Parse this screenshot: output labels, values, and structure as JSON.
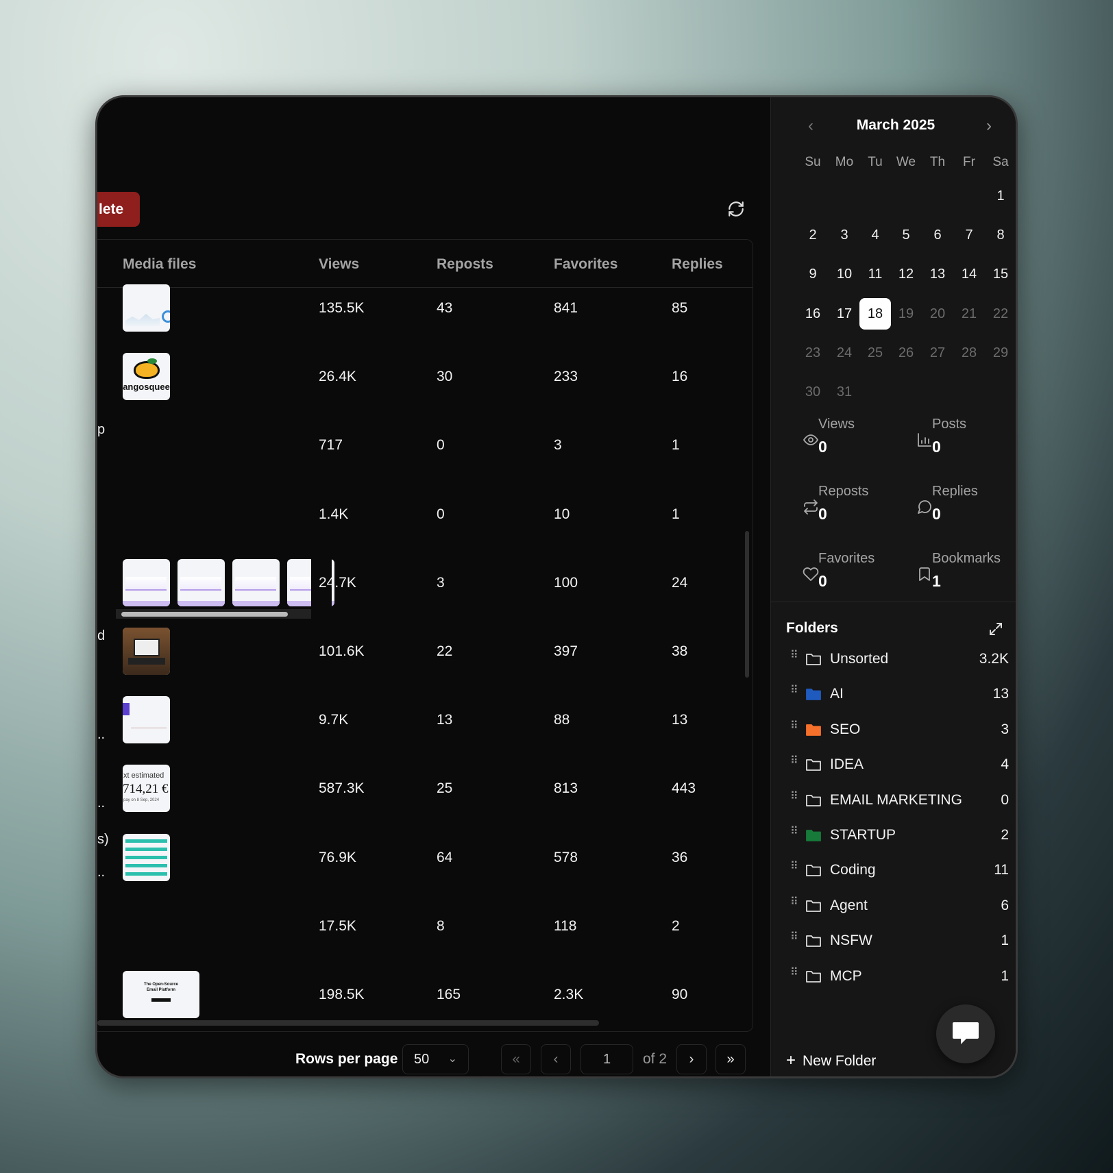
{
  "toolbar": {
    "delete_label": "lete",
    "refresh_icon": "refresh-icon"
  },
  "table": {
    "columns": [
      "Media files",
      "Views",
      "Reposts",
      "Favorites",
      "Replies"
    ],
    "rows": [
      {
        "fragment": "",
        "views": "135.5K",
        "reposts": "43",
        "favorites": "841",
        "replies": "85",
        "thumbs": [
          "analytics-screenshot"
        ]
      },
      {
        "fragment": "",
        "views": "26.4K",
        "reposts": "30",
        "favorites": "233",
        "replies": "16",
        "thumbs": [
          "mango-logo"
        ],
        "logo_text": "angosquee"
      },
      {
        "fragment": "p",
        "views": "717",
        "reposts": "0",
        "favorites": "3",
        "replies": "1",
        "thumbs": []
      },
      {
        "fragment": "",
        "views": "1.4K",
        "reposts": "0",
        "favorites": "10",
        "replies": "1",
        "thumbs": []
      },
      {
        "fragment": "",
        "views": "24.7K",
        "reposts": "3",
        "favorites": "100",
        "replies": "24",
        "thumbs": [
          "chart-screenshot",
          "chart-screenshot",
          "chart-screenshot",
          "chart-screenshot"
        ]
      },
      {
        "fragment": "d",
        "views": "101.6K",
        "reposts": "22",
        "favorites": "397",
        "replies": "38",
        "thumbs": [
          "laptop-photo"
        ]
      },
      {
        "fragment": "..",
        "views": "9.7K",
        "reposts": "13",
        "favorites": "88",
        "replies": "13",
        "thumbs": [
          "dashboard-screenshot"
        ]
      },
      {
        "fragment": "..",
        "views": "587.3K",
        "reposts": "25",
        "favorites": "813",
        "replies": "443",
        "thumbs": [
          "earnings-screenshot"
        ],
        "thumb_text": [
          "xt estimated",
          "714,21 €",
          "pay on 8 Sep, 2024"
        ]
      },
      {
        "fragment": "s)",
        "fragment2": "..",
        "views": "76.9K",
        "reposts": "64",
        "favorites": "578",
        "replies": "36",
        "thumbs": [
          "list-screenshot"
        ]
      },
      {
        "fragment": "",
        "views": "17.5K",
        "reposts": "8",
        "favorites": "118",
        "replies": "2",
        "thumbs": []
      },
      {
        "fragment": "",
        "views": "198.5K",
        "reposts": "165",
        "favorites": "2.3K",
        "replies": "90",
        "thumbs": [
          "landing-page-screenshot"
        ],
        "thumb_text": [
          "The Open-Source",
          "Email Platform"
        ]
      }
    ]
  },
  "pagination": {
    "rows_per_page_label": "Rows per page",
    "rows_per_page_value": "50",
    "page": "1",
    "of_label": "of 2",
    "first": "«",
    "prev": "‹",
    "next": "›",
    "last": "»"
  },
  "calendar": {
    "month": "March 2025",
    "weekdays": [
      "Su",
      "Mo",
      "Tu",
      "We",
      "Th",
      "Fr",
      "Sa"
    ],
    "selected": 18,
    "days_in_month": 31,
    "first_weekday": 6
  },
  "stats": [
    {
      "label": "Views",
      "value": "0",
      "icon": "eye-icon"
    },
    {
      "label": "Posts",
      "value": "0",
      "icon": "bar-chart-icon"
    },
    {
      "label": "Reposts",
      "value": "0",
      "icon": "repost-icon"
    },
    {
      "label": "Replies",
      "value": "0",
      "icon": "message-circle-icon"
    },
    {
      "label": "Favorites",
      "value": "0",
      "icon": "heart-icon"
    },
    {
      "label": "Bookmarks",
      "value": "1",
      "icon": "bookmark-icon"
    }
  ],
  "folders": {
    "title": "Folders",
    "new_label": "New Folder",
    "items": [
      {
        "name": "Unsorted",
        "count": "3.2K",
        "color": ""
      },
      {
        "name": "AI",
        "count": "13",
        "color": "#1f5bbf"
      },
      {
        "name": "SEO",
        "count": "3",
        "color": "#f5702b"
      },
      {
        "name": "IDEA",
        "count": "4",
        "color": ""
      },
      {
        "name": "EMAIL MARKETING",
        "count": "0",
        "color": ""
      },
      {
        "name": "STARTUP",
        "count": "2",
        "color": "#177a3a"
      },
      {
        "name": "Coding",
        "count": "11",
        "color": ""
      },
      {
        "name": "Agent",
        "count": "6",
        "color": ""
      },
      {
        "name": "NSFW",
        "count": "1",
        "color": ""
      },
      {
        "name": "MCP",
        "count": "1",
        "color": ""
      }
    ]
  },
  "colors": {
    "delete": "#8e1f1d",
    "panel": "#161616",
    "window": "#0a0a0a"
  }
}
